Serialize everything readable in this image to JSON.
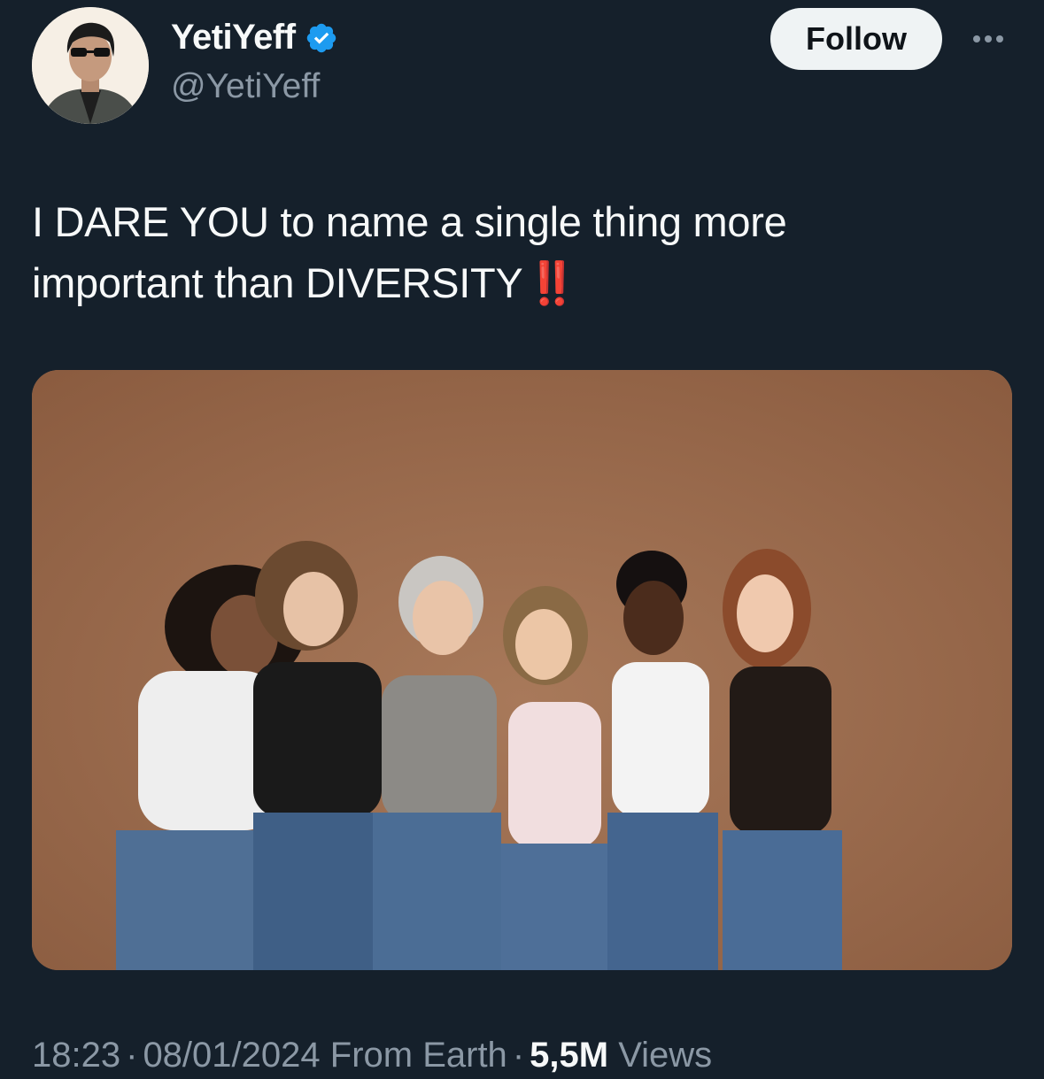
{
  "author": {
    "display_name": "YetiYeff",
    "handle": "@YetiYeff",
    "verified": true,
    "verified_color": "#1d9bf0"
  },
  "actions": {
    "follow_label": "Follow",
    "more_icon": "more-horizontal-icon"
  },
  "tweet": {
    "text_line1": "I DARE YOU to name a single thing more",
    "text_line2": "important than DIVERSITY",
    "emoji": "‼️",
    "media": {
      "kind": "photo",
      "background_color": "#9a6a4b"
    }
  },
  "meta": {
    "time": "18:23",
    "separator": "·",
    "date": "08/01/2024",
    "source": "From Earth",
    "views_count": "5,5M",
    "views_label": "Views"
  },
  "colors": {
    "background": "#15202b",
    "text_primary": "#f7f9f9",
    "text_secondary": "#8b98a5",
    "follow_button_bg": "#eff3f4",
    "emoji_red": "#e0261e"
  }
}
